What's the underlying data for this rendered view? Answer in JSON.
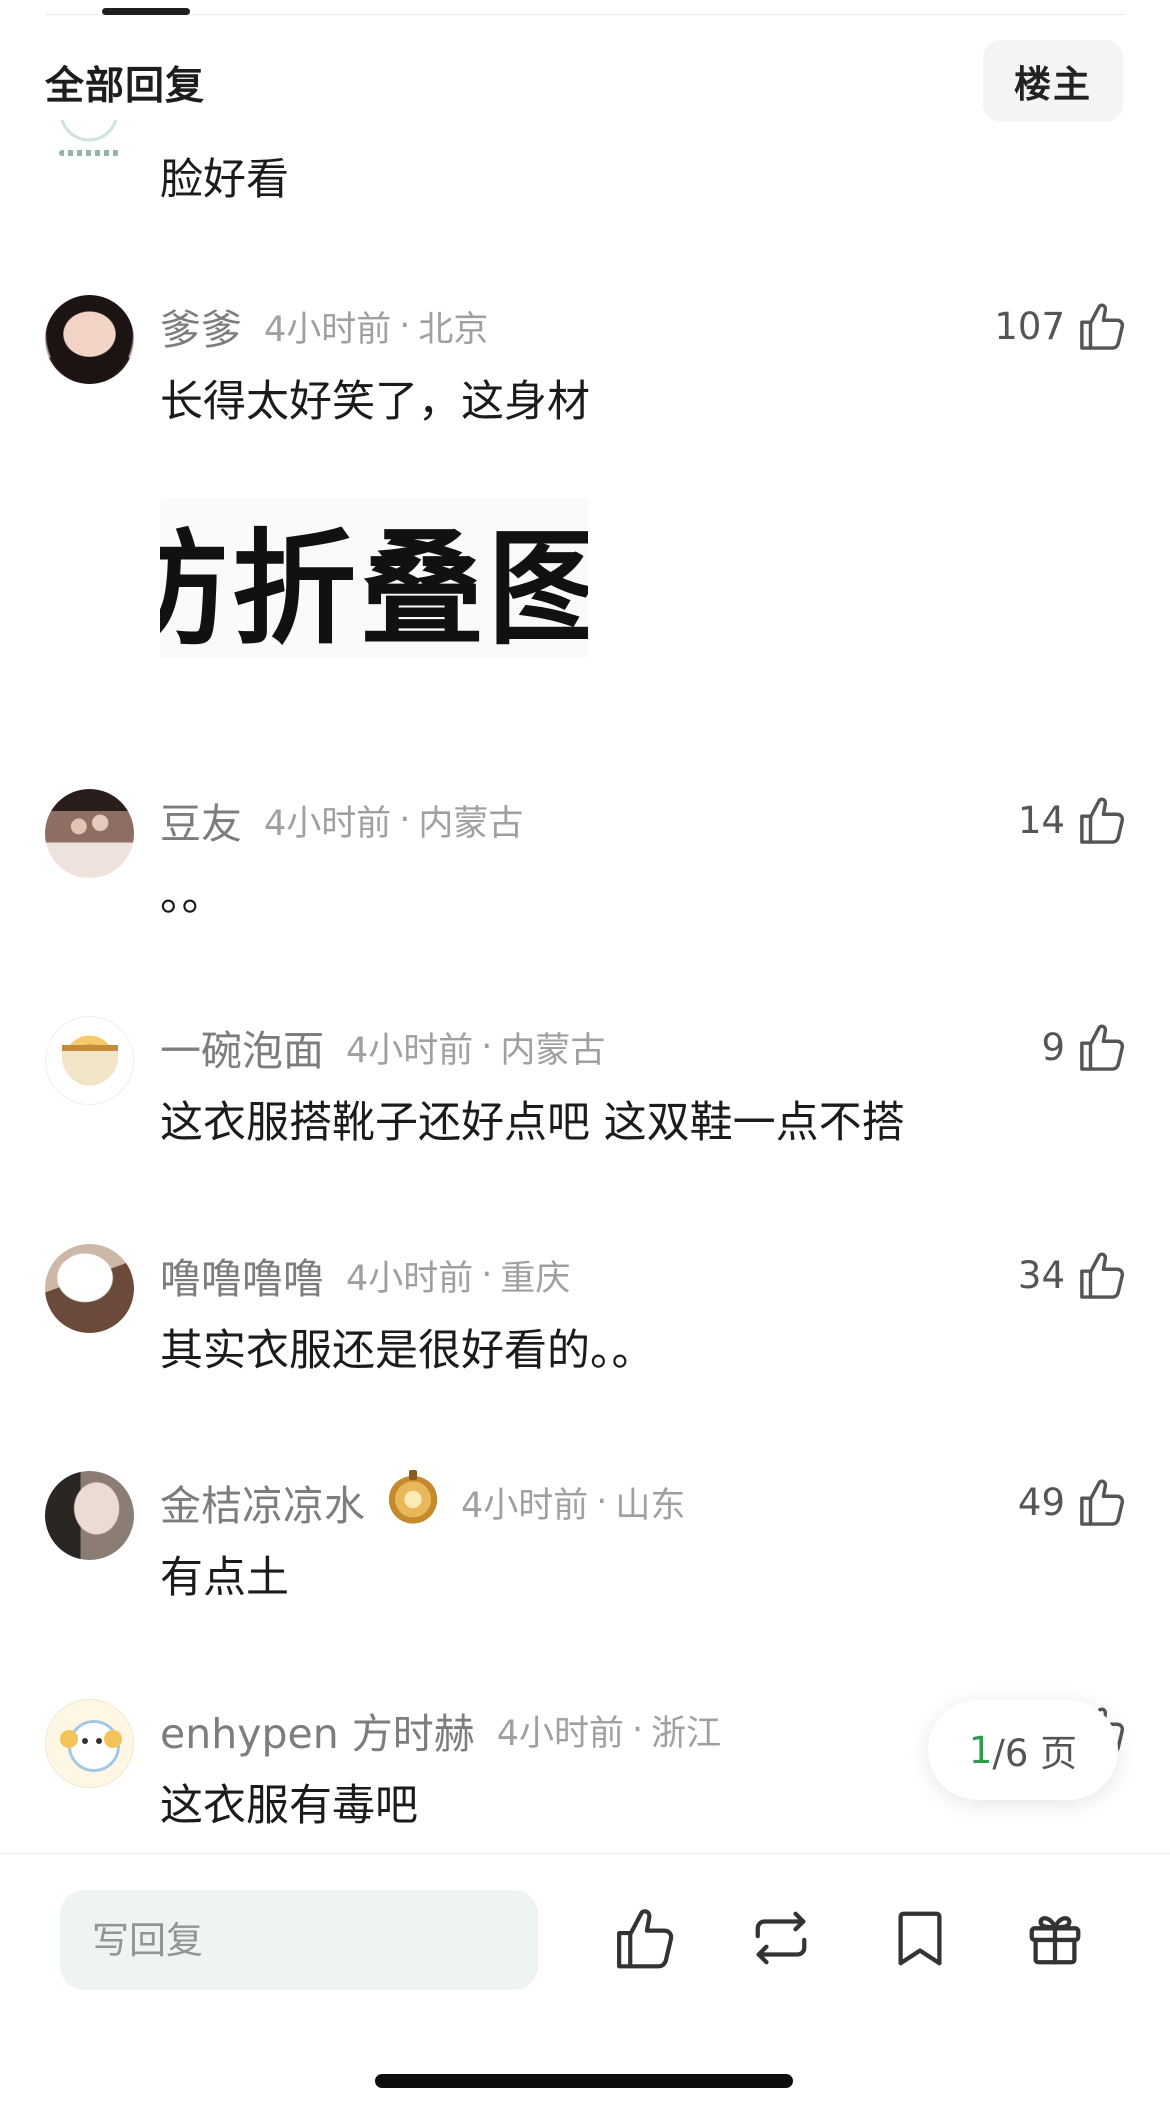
{
  "header": {
    "section_title": "全部回复",
    "op_button": "楼主"
  },
  "partial_comment": {
    "text": "脸好看"
  },
  "comments": [
    {
      "author": "爹爹",
      "time": "4小时前",
      "separator": "·",
      "location": "北京",
      "likes": "107",
      "text": "长得太好笑了，这身材",
      "image_text": "防折叠图"
    },
    {
      "author": "豆友",
      "time": "4小时前",
      "separator": "·",
      "location": "内蒙古",
      "likes": "14",
      "text": "。。"
    },
    {
      "author": "一碗泡面",
      "time": "4小时前",
      "separator": "·",
      "location": "内蒙古",
      "likes": "9",
      "text": "这衣服搭靴子还好点吧 这双鞋一点不搭"
    },
    {
      "author": "噜噜噜噜",
      "time": "4小时前",
      "separator": "·",
      "location": "重庆",
      "likes": "34",
      "text": "其实衣服还是很好看的。。"
    },
    {
      "author": "金桔凉凉水",
      "badge_icon": "lantern-badge-icon",
      "time": "4小时前",
      "separator": "·",
      "location": "山东",
      "likes": "49",
      "text": "有点土"
    },
    {
      "author": "enhypen 方时赫",
      "time": "4小时前",
      "separator": "·",
      "location": "浙江",
      "text": "这衣服有毒吧"
    }
  ],
  "pagination": {
    "current": "1",
    "rest": "/6 页"
  },
  "bottom_bar": {
    "reply_placeholder": "写回复",
    "icons": [
      "thumb-up-icon",
      "repost-icon",
      "bookmark-icon",
      "gift-icon"
    ]
  },
  "colors": {
    "accent_green": "#2e9d4c",
    "input_background": "#eef5f0",
    "muted_text": "#a0a0a0"
  }
}
